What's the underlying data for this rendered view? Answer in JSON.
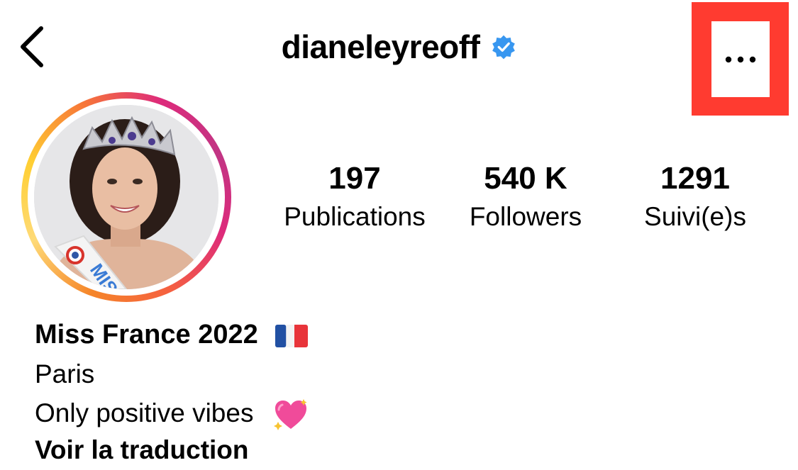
{
  "header": {
    "username": "dianeleyreoff",
    "back_icon": "chevron-left-icon",
    "verified_icon": "verified-badge-icon",
    "more_icon": "more-horizontal-icon"
  },
  "stats": [
    {
      "value": "197",
      "label": "Publications"
    },
    {
      "value": "540 K",
      "label": "Followers"
    },
    {
      "value": "1291",
      "label": "Suivi(e)s"
    }
  ],
  "bio": {
    "name": "Miss France 2022",
    "name_icon": "france-flag-icon",
    "location": "Paris",
    "text": "Only positive vibes",
    "text_icon": "sparkling-heart-icon",
    "translate": "Voir la traduction"
  },
  "colors": {
    "highlight": "#ff3b30",
    "verified": "#3897f0"
  }
}
